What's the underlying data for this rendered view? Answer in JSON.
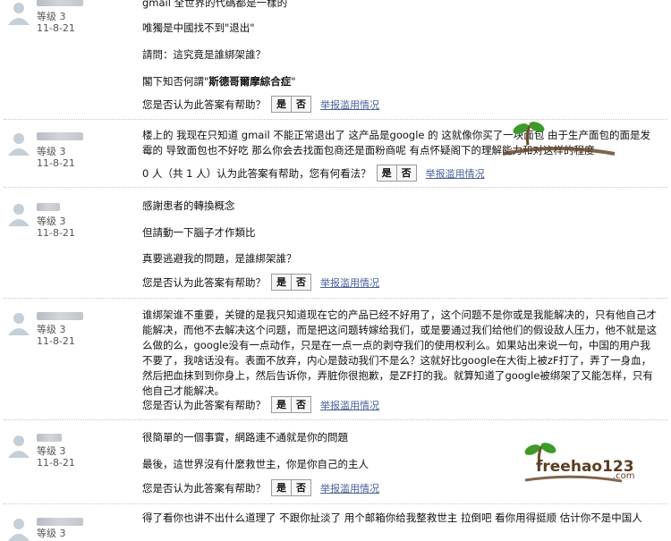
{
  "answers": [
    {
      "level": "等级 3",
      "date": "11-8-21",
      "paragraphs": [
        "gmail 全世界的代碼都是一樣的",
        "唯獨是中國找不到\"退出\"",
        "請問：這究竟是誰綁架誰？"
      ],
      "para4_prefix": "閣下知否何謂\"",
      "para4_bold": "斯德哥爾摩綜合症",
      "para4_suffix": "\"",
      "vote_question": "您是否认为此答案有帮助？",
      "yes": "是",
      "no": "否",
      "report": "举报滥用情况"
    },
    {
      "level": "等级 3",
      "date": "11-8-21",
      "body": "楼上的 我现在只知道 gmail 不能正常退出了 这产品是google 的 这就像你买了一块面包 由于生产面包的面是发霉的 导致面包也不好吃 那么你会去找面包商还是面粉商呢 有点怀疑阁下的理解能力和对这样的程度",
      "vote_question": "0 人（共 1 人）认为此答案有帮助，您有何看法？",
      "yes": "是",
      "no": "否",
      "report": "举报滥用情况"
    },
    {
      "level": "等级 3",
      "date": "11-8-21",
      "paragraphs": [
        "感謝患者的轉換概念",
        "但請動一下腦子才作類比",
        "真要逃避我的問題，是誰綁架誰？"
      ],
      "vote_question": "您是否认为此答案有帮助？",
      "yes": "是",
      "no": "否",
      "report": "举报滥用情况"
    },
    {
      "level": "等级 3",
      "date": "11-8-21",
      "body": "谁绑架谁不重要，关键的是我只知道现在它的产品已经不好用了，这个问题不是你或是我能解决的，只有他自己才能解决，而他不去解决这个问题，而是把这问题转嫁给我们，或是要通过我们给他们的假设敌人压力，他不就是这么做的么，google没有一点动作，只是在一点一点的剥夺我们的使用权利么。如果站出来说一句，中国的用户我不要了，我啥话没有。表面不放弃，内心是鼓动我们不是么？这就好比google在大街上被zF打了，弄了一身血，然后把血抹到到你身上，然后告诉你，弄脏你很抱歉，是ZF打的我。就算知道了google被绑架了又能怎样，只有他自己才能解决。",
      "vote_question": "您是否认为此答案有帮助？",
      "yes": "是",
      "no": "否",
      "report": "举报滥用情况"
    },
    {
      "level": "等级 3",
      "date": "11-8-21",
      "paragraphs": [
        "很簡單的一個事實，網路連不通就是你的問題",
        "最後，這世界沒有什麼救世主，你是你自己的主人"
      ],
      "vote_question": "您是否认为此答案有帮助？",
      "yes": "是",
      "no": "否",
      "report": "举报滥用情况"
    },
    {
      "level": "等级 3",
      "body": "得了看你也讲不出什么道理了 不跟你扯淡了 用个邮箱你给我整救世主 拉倒吧 看你用得挺顺 估计你不是中国人"
    }
  ],
  "watermark": {
    "text": "freehao123",
    "suffix": ".com"
  },
  "colors": {
    "link": "#4a5f9a",
    "divider": "#c8c8c8"
  }
}
